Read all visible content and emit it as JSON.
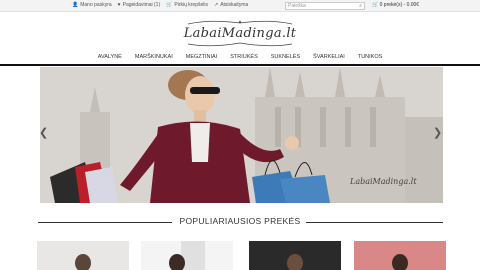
{
  "topbar": {
    "links": [
      {
        "icon": "user-icon",
        "glyph": "👤",
        "label": "Mano paskyra"
      },
      {
        "icon": "heart-icon",
        "glyph": "♥",
        "label": "Pageidavimai (1)"
      },
      {
        "icon": "cart-icon",
        "glyph": "🛒",
        "label": "Pirkių krepšelis"
      },
      {
        "icon": "share-icon",
        "glyph": "↗",
        "label": "Atsiskaityma"
      }
    ],
    "search_placeholder": "Paieška",
    "cart_label": "0 prekė(s) - 0.00€"
  },
  "logo": {
    "text": "LabaiMadinga.lt"
  },
  "nav": {
    "items": [
      "AVALYNĖ",
      "MARŠKINUKAI",
      "MEGZTINIAI",
      "STRIUKĖS",
      "SUKNELĖS",
      "ŠVARKELIAI",
      "TUNIKOS"
    ]
  },
  "hero": {
    "watermark": "LabaiMadinga.lt",
    "prev_glyph": "❮",
    "next_glyph": "❯"
  },
  "section": {
    "title": "POPULIARIAUSIOS PREKĖS"
  },
  "colors": {
    "accent": "#111111",
    "dress": "#6e1a2c",
    "bag_blue": "#3d7ab8",
    "bag_red": "#b8202a"
  }
}
